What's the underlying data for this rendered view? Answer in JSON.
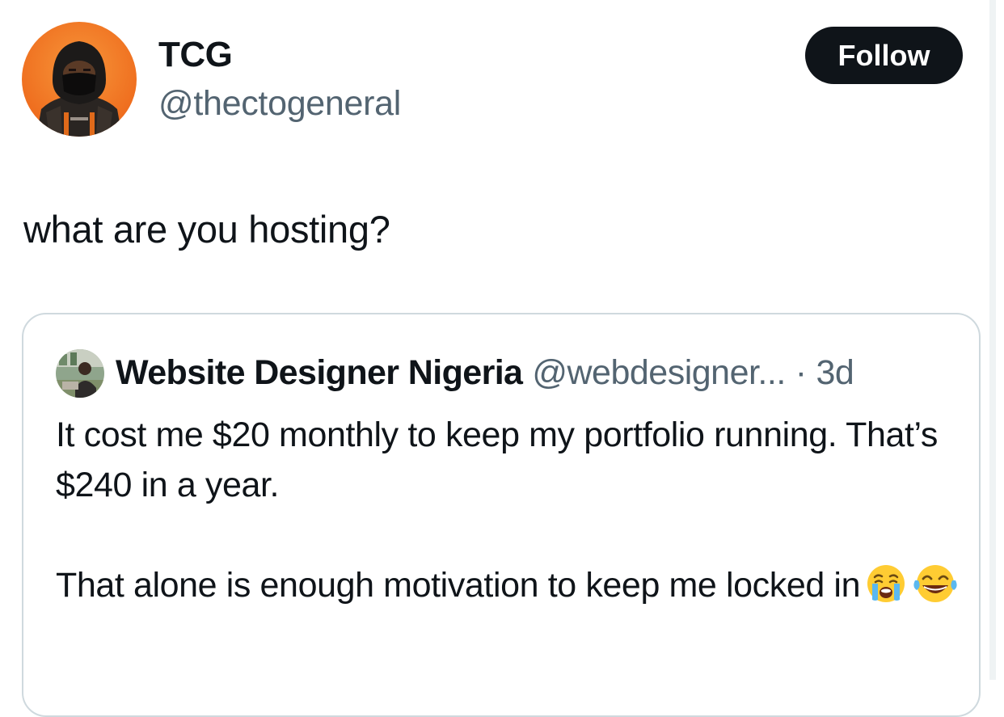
{
  "author": {
    "display_name": "TCG",
    "handle": "@thectogeneral",
    "avatar_icon": "profile-avatar"
  },
  "follow_button": {
    "label": "Follow"
  },
  "tweet": {
    "text": "what are you hosting?"
  },
  "quoted_tweet": {
    "display_name": "Website Designer Nigeria",
    "handle": "@webdesigner...",
    "separator": "·",
    "time": "3d",
    "paragraphs": [
      "It cost me $20 monthly to keep my portfolio running. That’s $240 in a year.",
      "That alone is enough motivation to keep me locked in"
    ],
    "emojis": [
      "loudly-crying-face-emoji",
      "face-with-tears-of-joy-emoji"
    ]
  },
  "colors": {
    "text_primary": "#0f1419",
    "text_secondary": "#536471",
    "button_bg": "#0f1419",
    "card_border": "#cfd9de",
    "avatar_bg": "#f07a23"
  }
}
